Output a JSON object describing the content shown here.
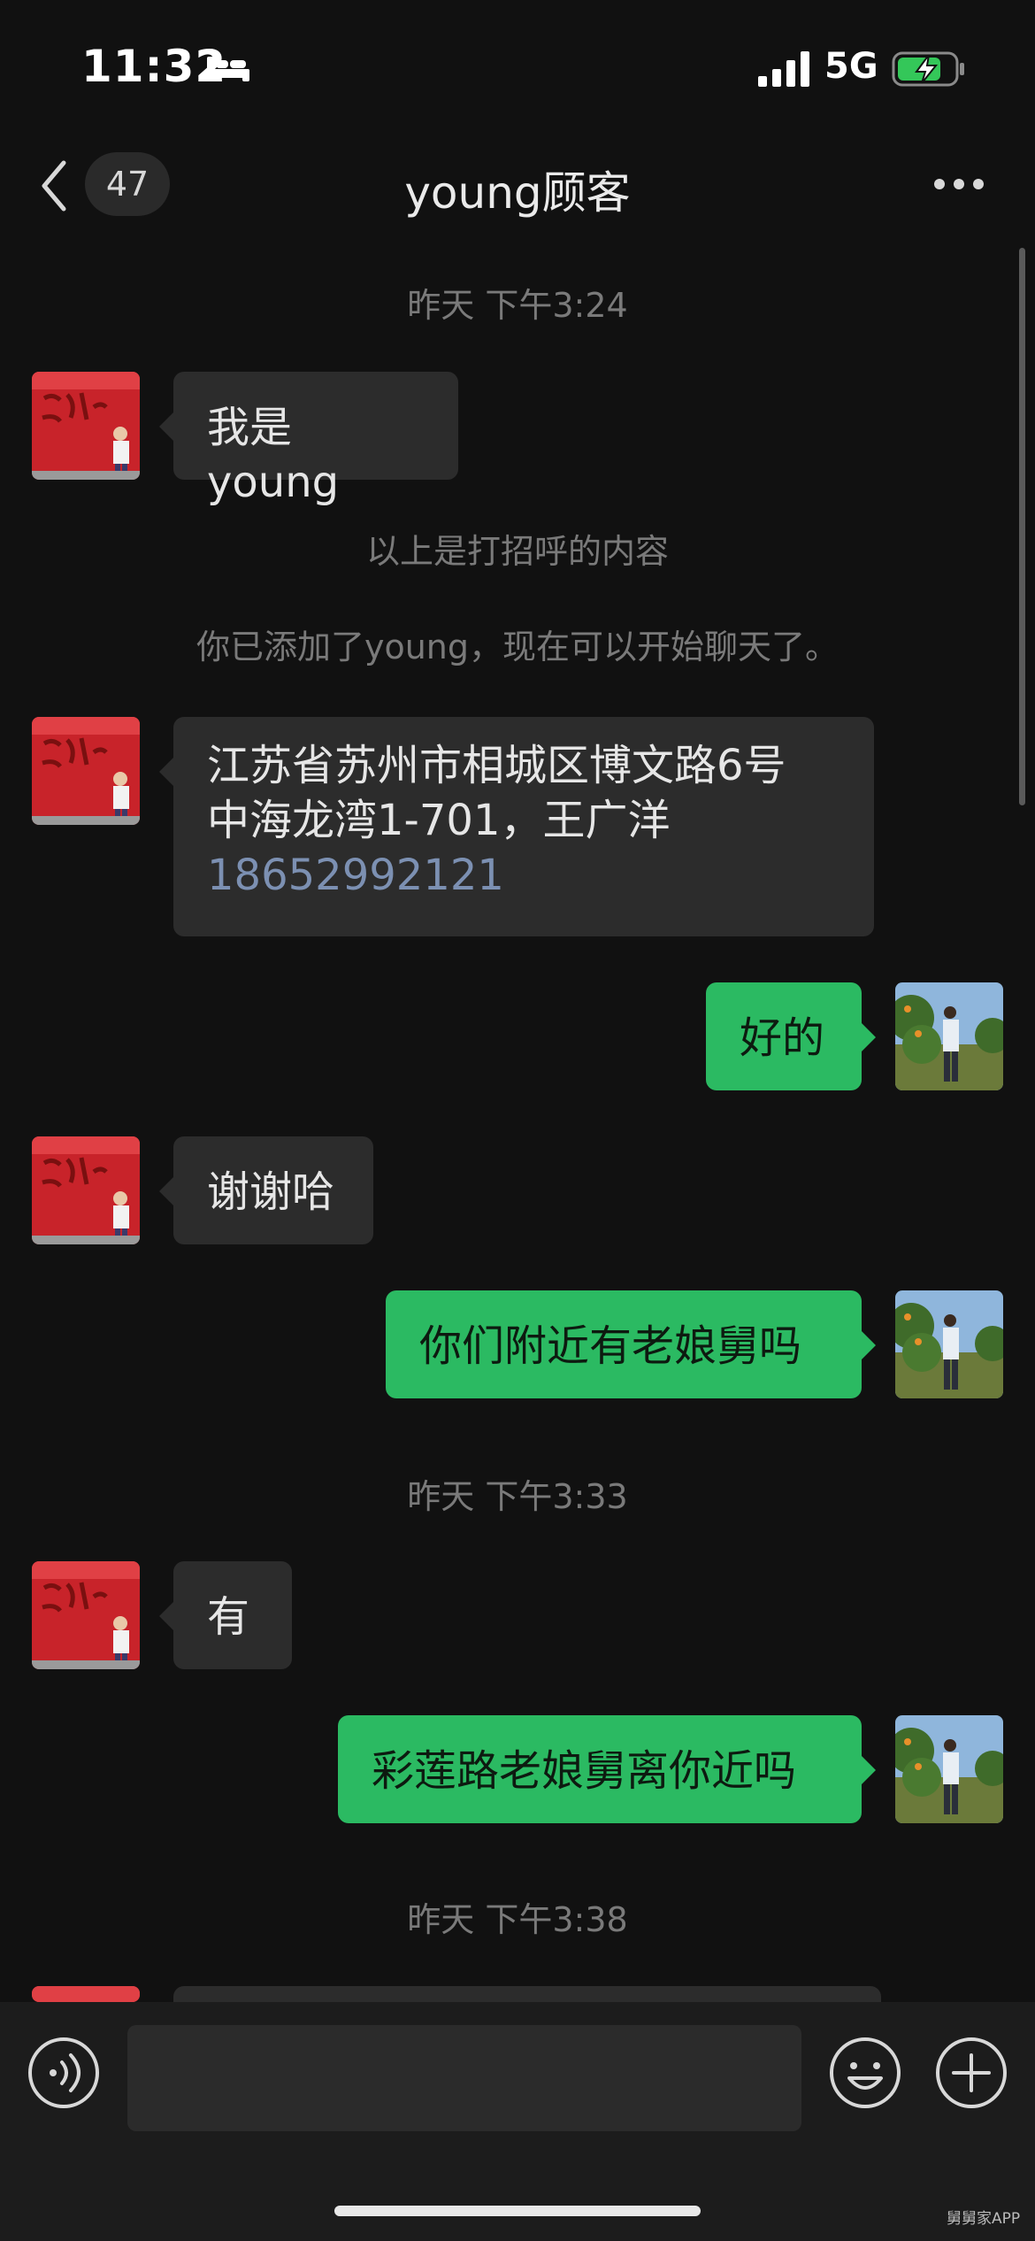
{
  "status_bar": {
    "time": "11:32",
    "network": "5G"
  },
  "nav": {
    "unread_count": "47",
    "title": "young顾客"
  },
  "messages": {
    "ts1": "昨天 下午3:24",
    "m1": "我是 young",
    "sys1": "以上是打招呼的内容",
    "sys2": "你已添加了young，现在可以开始聊天了。",
    "m2_line1": "江苏省苏州市相城区博文路6号",
    "m2_line2": "中海龙湾1-701，王广洋",
    "m2_phone": "18652992121",
    "m3": "好的",
    "m4": "谢谢哈",
    "m5": "你们附近有老娘舅吗",
    "ts2": "昨天 下午3:33",
    "m6": "有",
    "m7": "彩莲路老娘舅离你近吗",
    "ts3": "昨天 下午3:38"
  },
  "watermark": "舅舅家APP",
  "colors": {
    "background": "#111111",
    "outgoing_bubble": "#2bba62",
    "incoming_bubble": "#2c2c2c",
    "phone_link": "#7c90b2"
  }
}
